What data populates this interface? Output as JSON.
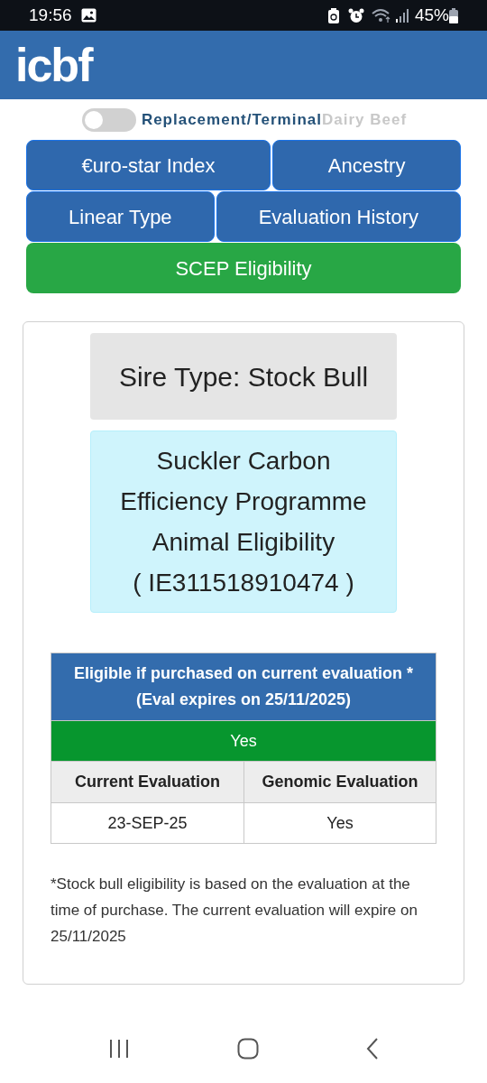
{
  "status_bar": {
    "time": "19:56",
    "battery": "45%"
  },
  "header": {
    "logo": "icbf"
  },
  "toggle": {
    "on": false,
    "left_label": "Replacement/Terminal",
    "right_label": "Dairy Beef"
  },
  "tab_rows": [
    {
      "tabs": [
        {
          "label": "€uro-star Index",
          "selected": false
        },
        {
          "label": "Ancestry",
          "selected": false
        }
      ]
    },
    {
      "tabs": [
        {
          "label": "Linear Type",
          "selected": false
        },
        {
          "label": "Evaluation History",
          "selected": false
        }
      ]
    },
    {
      "tabs": [
        {
          "label": "SCEP Eligibility",
          "selected": true
        }
      ]
    }
  ],
  "sire_type": "Sire Type: Stock Bull",
  "programme": {
    "lines": [
      "Suckler Carbon",
      "Efficiency Programme",
      "Animal Eligibility",
      "( IE311518910474 )"
    ]
  },
  "table": {
    "title_lines": [
      "Eligible if purchased on current evaluation *",
      "(Eval expires on 25/11/2025)"
    ],
    "result": "Yes",
    "columns": [
      "Current Evaluation",
      "Genomic Evaluation"
    ],
    "rows": [
      [
        "23-SEP-25",
        "Yes"
      ]
    ]
  },
  "footnote": "*Stock bull eligibility is based on the evaluation at the time of purchase. The current evaluation will expire on 25/11/2025"
}
